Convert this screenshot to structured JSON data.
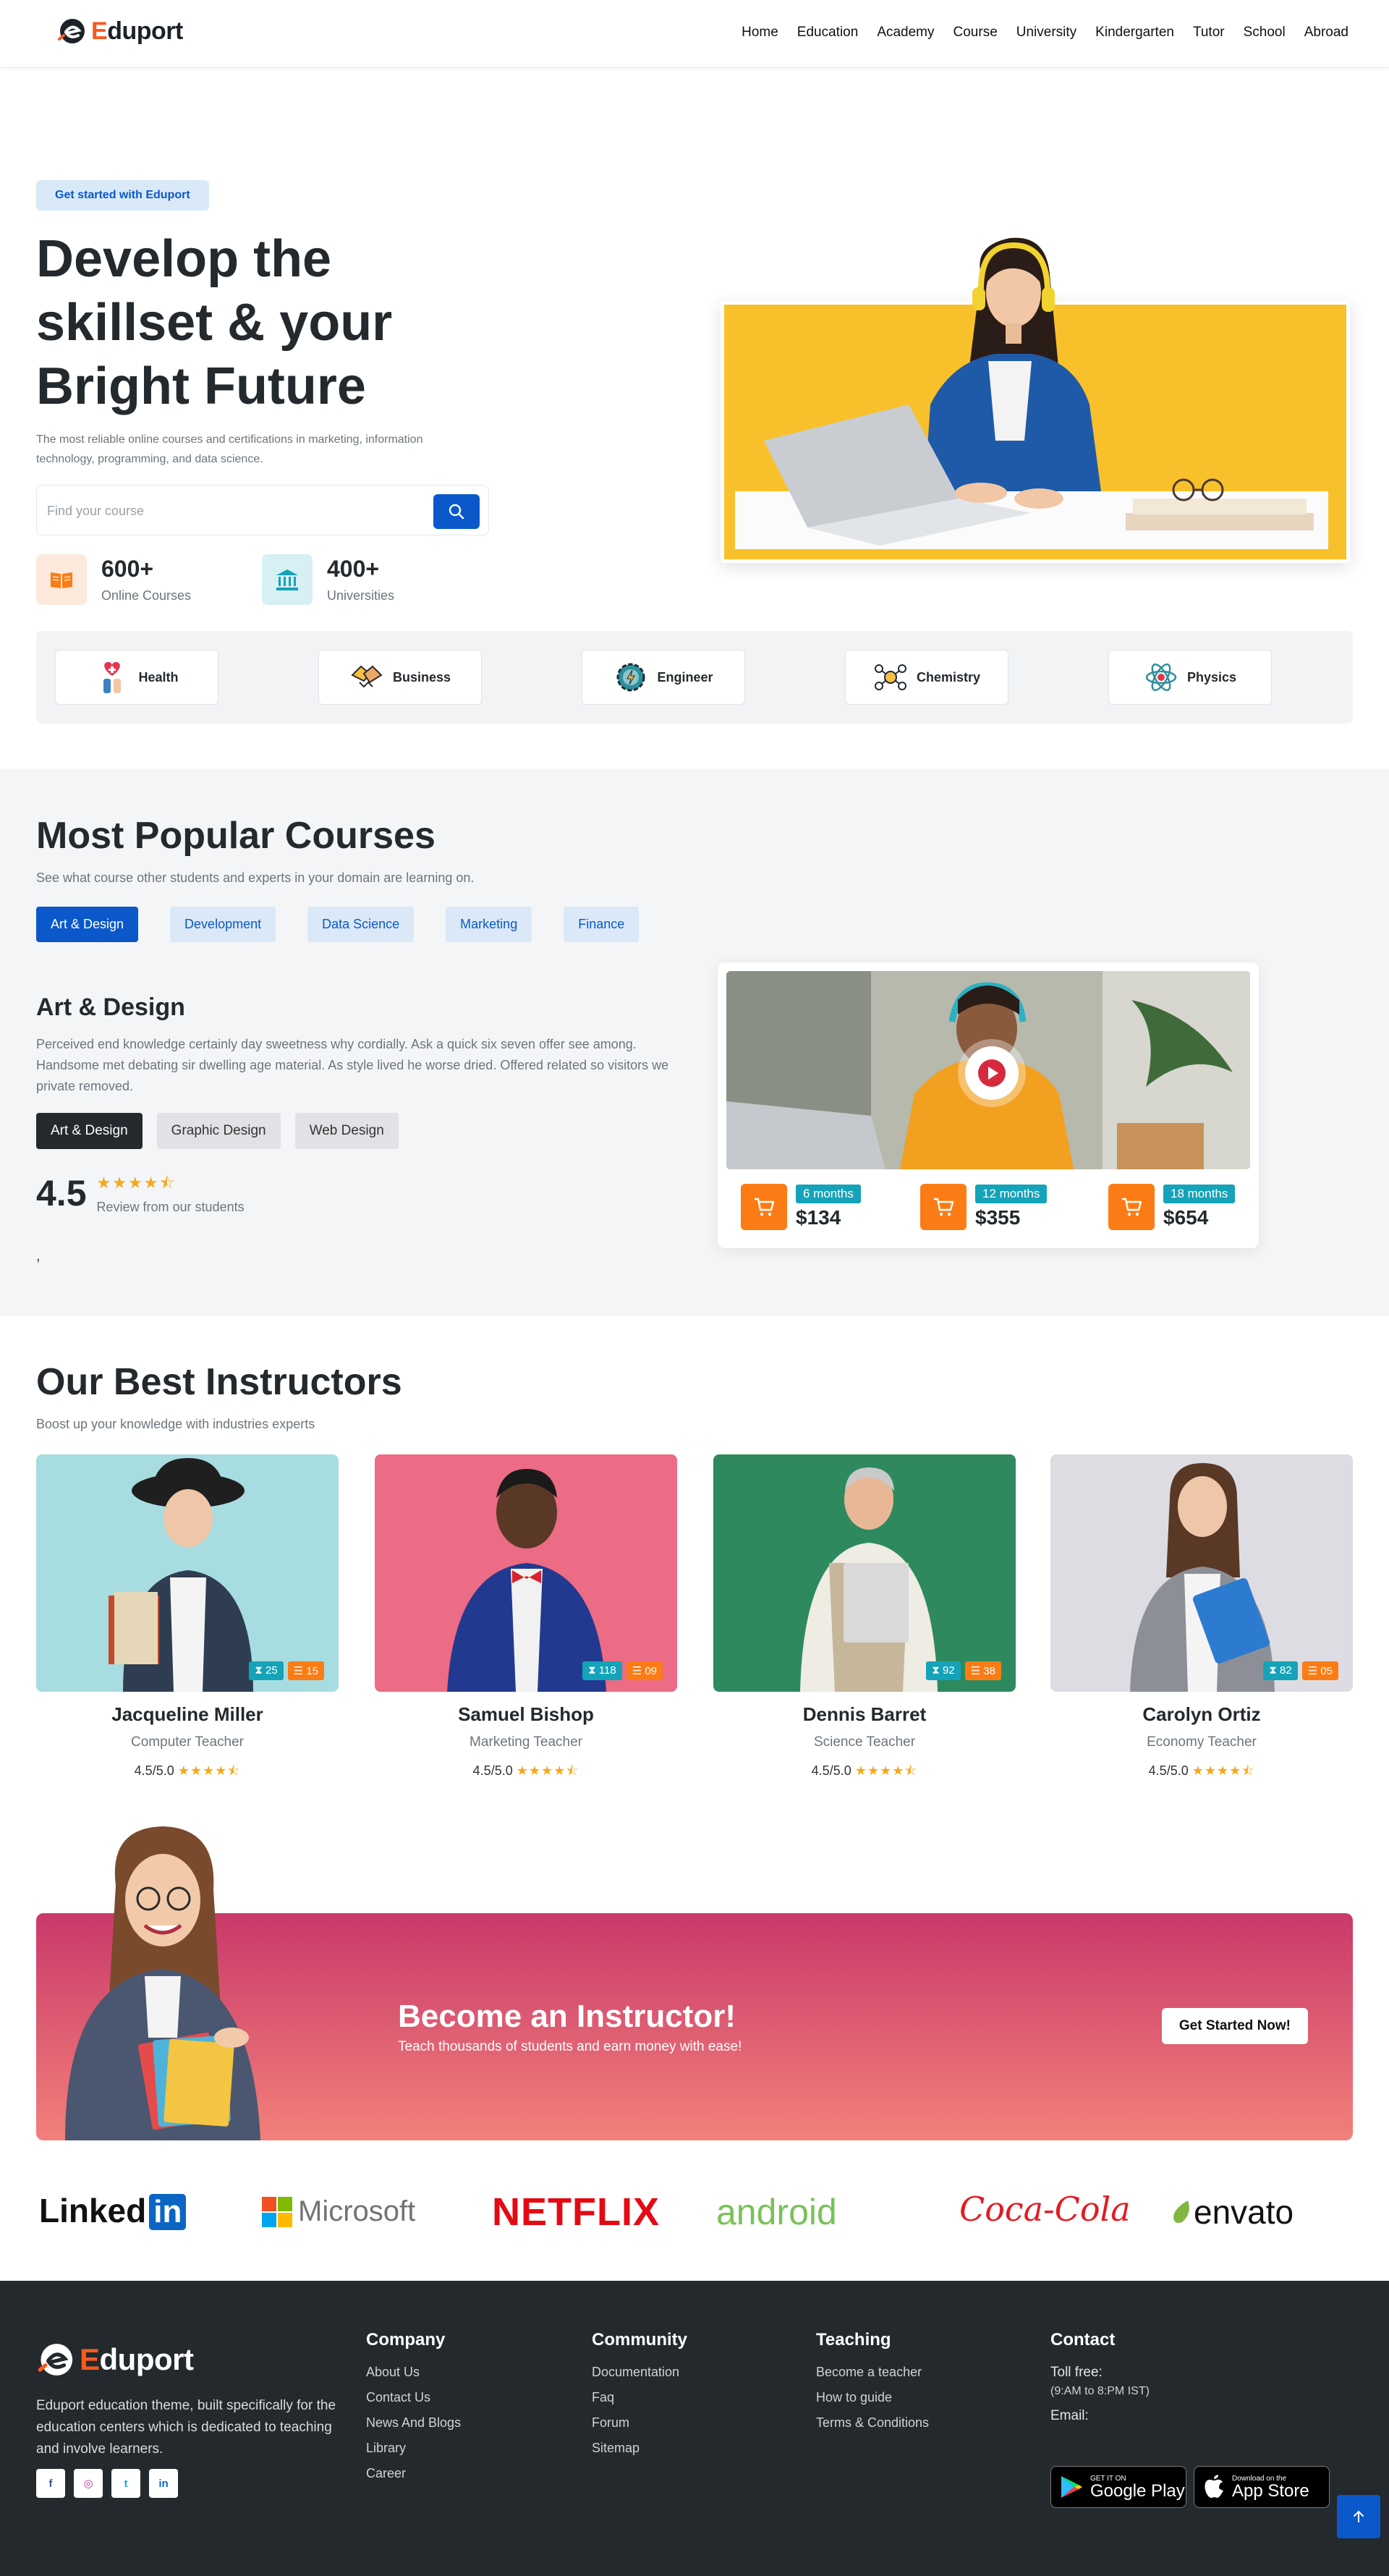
{
  "brand": {
    "name_first": "E",
    "name_rest": "duport"
  },
  "nav": {
    "items": [
      "Home",
      "Education",
      "Academy",
      "Course",
      "University",
      "Kindergarten",
      "Tutor",
      "School",
      "Abroad"
    ]
  },
  "hero": {
    "pill": "Get started with Eduport",
    "title": "Develop the skillset & your Bright Future",
    "lead": "The most reliable online courses and certifications in marketing, information technology, programming, and data science.",
    "search_placeholder": "Find your course",
    "stats": [
      {
        "num": "600+",
        "label": "Online Courses"
      },
      {
        "num": "400+",
        "label": "Universities"
      }
    ]
  },
  "categories": [
    "Health",
    "Business",
    "Engineer",
    "Chemistry",
    "Physics"
  ],
  "popular": {
    "title": "Most Popular Courses",
    "subtitle": "See what course other students and experts in your domain are learning on.",
    "tabs": [
      "Art & Design",
      "Development",
      "Data Science",
      "Marketing",
      "Finance"
    ],
    "course_title": "Art & Design",
    "course_desc": "Perceived end knowledge certainly day sweetness why cordially. Ask a quick six seven offer see among. Handsome met debating sir dwelling age material. As style lived he worse dried. Offered related so visitors we private removed.",
    "subtabs": [
      "Art & Design",
      "Graphic Design",
      "Web Design"
    ],
    "rating": "4.5",
    "rating_text": "Review from our students",
    "stars": "★★★★⯪",
    "comma": ",",
    "plans": [
      {
        "duration": "6 months",
        "price": "$134"
      },
      {
        "duration": "12 months",
        "price": "$355"
      },
      {
        "duration": "18 months",
        "price": "$654"
      }
    ]
  },
  "instructors": {
    "title": "Our Best Instructors",
    "subtitle": "Boost up your knowledge with industries experts",
    "rating_prefix": "4.5/5.0",
    "stars": "★★★★⯪",
    "people": [
      {
        "name": "Jacqueline Miller",
        "role": "Computer Teacher",
        "students": "25",
        "courses": "15"
      },
      {
        "name": "Samuel Bishop",
        "role": "Marketing Teacher",
        "students": "118",
        "courses": "09"
      },
      {
        "name": "Dennis Barret",
        "role": "Science Teacher",
        "students": "92",
        "courses": "38"
      },
      {
        "name": "Carolyn Ortiz",
        "role": "Economy Teacher",
        "students": "82",
        "courses": "05"
      }
    ]
  },
  "cta": {
    "title": "Become an Instructor!",
    "subtitle": "Teach thousands of students and earn money with ease!",
    "button": "Get Started Now!"
  },
  "partners": [
    "Linked",
    "in",
    "Microsoft",
    "NETFLIX",
    "android",
    "Coca-Cola",
    "envato"
  ],
  "footer": {
    "description": "Eduport education theme, built specifically for the education centers which is dedicated to teaching and involve learners.",
    "social": [
      "f",
      "◎",
      "t",
      "in"
    ],
    "company": {
      "title": "Company",
      "links": [
        "About Us",
        "Contact Us",
        "News And Blogs",
        "Library",
        "Career"
      ]
    },
    "community": {
      "title": "Community",
      "links": [
        "Documentation",
        "Faq",
        "Forum",
        "Sitemap"
      ]
    },
    "teaching": {
      "title": "Teaching",
      "links": [
        "Become a teacher",
        "How to guide",
        "Terms & Conditions"
      ]
    },
    "contact": {
      "title": "Contact",
      "toll_free": "Toll free:",
      "hours": "(9:AM to 8:PM IST)",
      "email": "Email:"
    },
    "google_play": {
      "small": "GET IT ON",
      "big": "Google Play"
    },
    "app_store": {
      "small": "Download on the",
      "big": "App Store"
    }
  },
  "colors": {
    "primary": "#0a58ca",
    "orange": "#fb7c14",
    "teal": "#14a3b8",
    "dark": "#24292d",
    "hero_yellow": "#f8c12c"
  }
}
